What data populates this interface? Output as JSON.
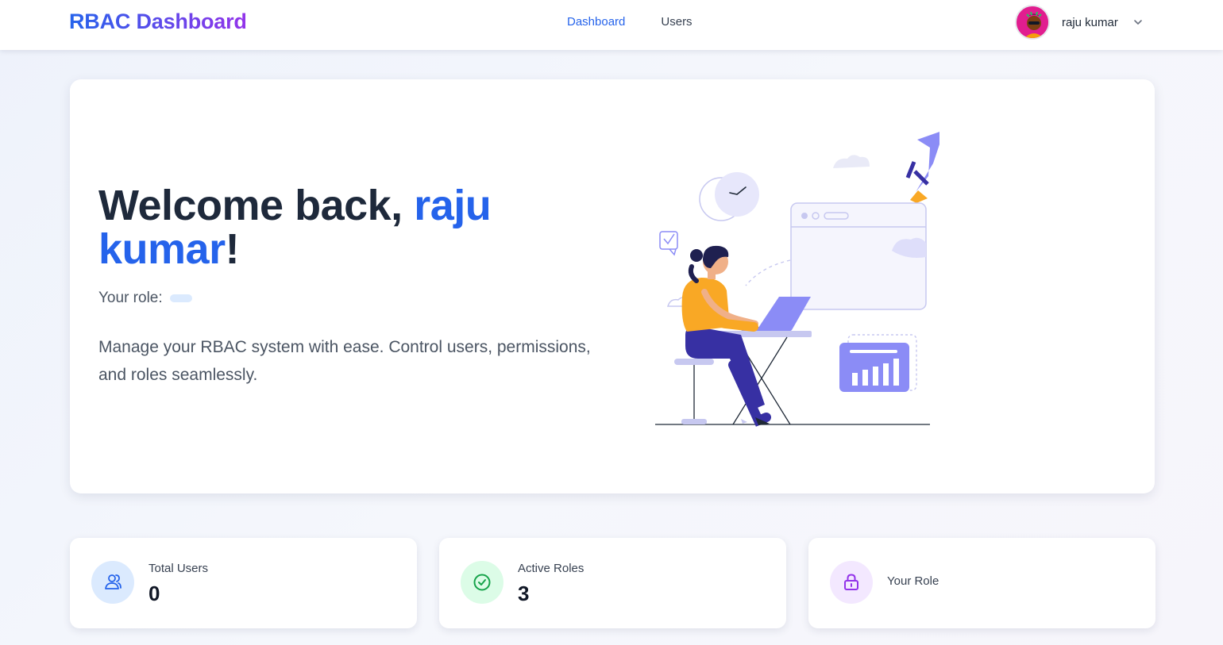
{
  "navbar": {
    "brand": "RBAC Dashboard",
    "links": [
      {
        "label": "Dashboard",
        "active": true
      },
      {
        "label": "Users",
        "active": false
      }
    ],
    "user": {
      "name": "raju kumar",
      "avatar_icon": "avatar-image",
      "menu_icon": "chevron-down-icon"
    }
  },
  "hero": {
    "welcome_prefix": "Welcome back, ",
    "user_name": "raju kumar",
    "welcome_suffix": "!",
    "role_label": "Your role:",
    "role_value": "",
    "tagline": "Manage your RBAC system with ease. Control users, permissions, and roles seamlessly.",
    "illustration": "person-at-laptop-illustration"
  },
  "stats": [
    {
      "label": "Total Users",
      "value": "0",
      "icon": "users-icon",
      "color": "#2563eb",
      "bg": "#dbeafe"
    },
    {
      "label": "Active Roles",
      "value": "3",
      "icon": "check-circle-icon",
      "color": "#16a34a",
      "bg": "#dcfce7"
    },
    {
      "label": "Your Role",
      "value": "",
      "icon": "lock-icon",
      "color": "#9333ea",
      "bg": "#f3e8ff"
    }
  ],
  "colors": {
    "accent": "#2563eb",
    "brand_gradient_end": "#9333ea",
    "illustration_purple": "#8b8cf6",
    "illustration_orange": "#f9a825"
  }
}
